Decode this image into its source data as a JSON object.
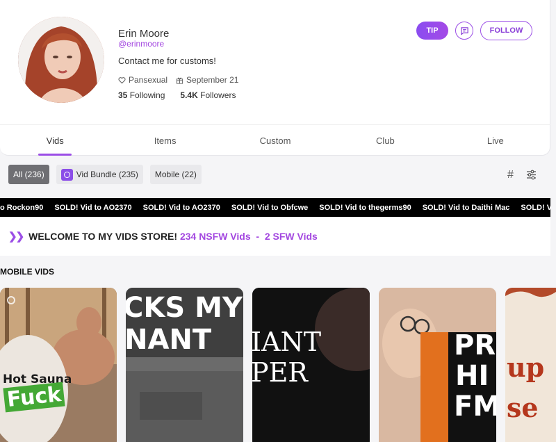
{
  "profile": {
    "name": "Erin Moore",
    "handle": "@erinmoore",
    "bio": "Contact me for customs!",
    "orientation": "Pansexual",
    "birthday": "September 21",
    "following_count": "35",
    "following_label": "Following",
    "followers_count": "5.4K",
    "followers_label": "Followers"
  },
  "actions": {
    "tip_label": "TIP",
    "follow_label": "FOLLOW"
  },
  "tabs": [
    {
      "label": "Vids",
      "active": true
    },
    {
      "label": "Items"
    },
    {
      "label": "Custom"
    },
    {
      "label": "Club"
    },
    {
      "label": "Live"
    }
  ],
  "filters": {
    "all": "All (236)",
    "bundle": "Vid Bundle (235)",
    "mobile": "Mobile (22)"
  },
  "ticker": [
    "o Rockon90",
    "SOLD! Vid to AO2370",
    "SOLD! Vid to AO2370",
    "SOLD! Vid to Obfcwe",
    "SOLD! Vid to thegerms90",
    "SOLD! Vid to Daithi Mac",
    "SOLD! Vi"
  ],
  "welcome": {
    "text": "WELCOME TO MY VIDS STORE!",
    "nsfw": "234 NSFW Vids",
    "separator": "-",
    "sfw": "2 SFW Vids"
  },
  "section": {
    "title": "MOBILE VIDS"
  },
  "thumbnails": {
    "t1_line1": "Hot Sauna",
    "t1_line2": "Fuck",
    "t2_line1": "CKS MY",
    "t2_line2": "NANT",
    "t3_line1": "IANT",
    "t3_line2": "PER",
    "t4_line1": "PR",
    "t4_line2": "HI",
    "t4_line3": "FM",
    "t5_line1": "up",
    "t5_line2": "se"
  },
  "colors": {
    "accent": "#9b4ee6",
    "handle": "#a347e0",
    "ticker_bg": "#000000"
  }
}
